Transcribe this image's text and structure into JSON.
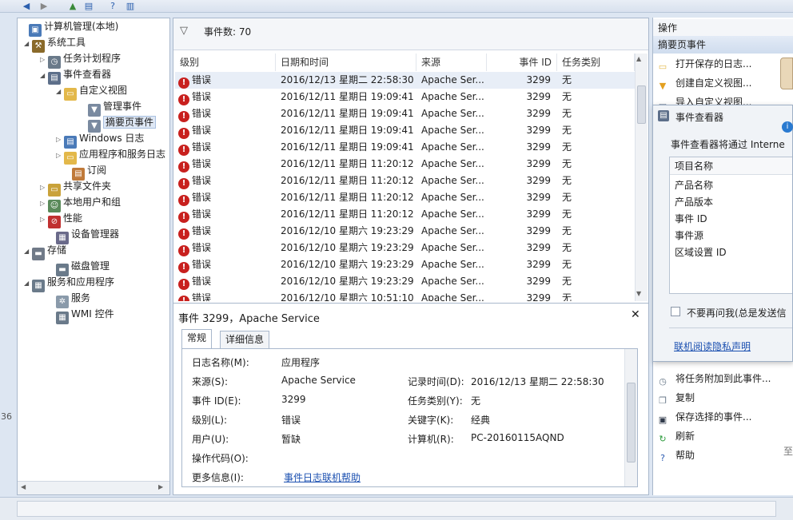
{
  "tree": {
    "items": [
      {
        "label": "计算机管理(本地)",
        "icon": "computer-icon",
        "color": "#4a7ab8",
        "glyph": "▣"
      },
      {
        "label": "系统工具",
        "icon": "tools-icon",
        "color": "#8a6a2a",
        "glyph": "⚒"
      },
      {
        "label": "任务计划程序",
        "icon": "clock-icon",
        "color": "#6a7a8a",
        "glyph": "◷"
      },
      {
        "label": "事件查看器",
        "icon": "event-viewer-icon",
        "color": "#5d6f8a",
        "glyph": "▤"
      },
      {
        "label": "自定义视图",
        "icon": "folder-icon",
        "color": "#e3b84a",
        "glyph": "▭"
      },
      {
        "label": "管理事件",
        "icon": "filter-icon",
        "color": "#7a8aa0",
        "glyph": "▼"
      },
      {
        "label": "摘要页事件",
        "icon": "filter-icon",
        "color": "#7a8aa0",
        "glyph": "▼"
      },
      {
        "label": "Windows 日志",
        "icon": "windows-log-icon",
        "color": "#4a7ab8",
        "glyph": "▤"
      },
      {
        "label": "应用程序和服务日志",
        "icon": "folder-icon",
        "color": "#e3b84a",
        "glyph": "▭"
      },
      {
        "label": "订阅",
        "icon": "subscription-icon",
        "color": "#c07a3a",
        "glyph": "▤"
      },
      {
        "label": "共享文件夹",
        "icon": "shared-folder-icon",
        "color": "#c9a23a",
        "glyph": "▭"
      },
      {
        "label": "本地用户和组",
        "icon": "users-icon",
        "color": "#5a8a5a",
        "glyph": "☺"
      },
      {
        "label": "性能",
        "icon": "performance-icon",
        "color": "#c03030",
        "glyph": "⊘"
      },
      {
        "label": "设备管理器",
        "icon": "device-manager-icon",
        "color": "#6a6a8a",
        "glyph": "▦"
      },
      {
        "label": "存储",
        "icon": "storage-icon",
        "color": "#707a88",
        "glyph": "▬"
      },
      {
        "label": "磁盘管理",
        "icon": "disk-icon",
        "color": "#6a7a8a",
        "glyph": "▬"
      },
      {
        "label": "服务和应用程序",
        "icon": "services-apps-icon",
        "color": "#6a7a8a",
        "glyph": "▦"
      },
      {
        "label": "服务",
        "icon": "services-icon",
        "color": "#8a9aaa",
        "glyph": "✲"
      },
      {
        "label": "WMI 控件",
        "icon": "wmi-icon",
        "color": "#6a7a8a",
        "glyph": "▦"
      }
    ]
  },
  "filter": {
    "label": "事件数: 70"
  },
  "grid": {
    "headers": [
      "级别",
      "日期和时间",
      "来源",
      "事件 ID",
      "任务类别"
    ],
    "rows": [
      {
        "level": "错误",
        "datetime": "2016/12/13 星期二 22:58:30",
        "source": "Apache Ser...",
        "id": "3299",
        "category": "无"
      },
      {
        "level": "错误",
        "datetime": "2016/12/11 星期日 19:09:41",
        "source": "Apache Ser...",
        "id": "3299",
        "category": "无"
      },
      {
        "level": "错误",
        "datetime": "2016/12/11 星期日 19:09:41",
        "source": "Apache Ser...",
        "id": "3299",
        "category": "无"
      },
      {
        "level": "错误",
        "datetime": "2016/12/11 星期日 19:09:41",
        "source": "Apache Ser...",
        "id": "3299",
        "category": "无"
      },
      {
        "level": "错误",
        "datetime": "2016/12/11 星期日 19:09:41",
        "source": "Apache Ser...",
        "id": "3299",
        "category": "无"
      },
      {
        "level": "错误",
        "datetime": "2016/12/11 星期日 11:20:12",
        "source": "Apache Ser...",
        "id": "3299",
        "category": "无"
      },
      {
        "level": "错误",
        "datetime": "2016/12/11 星期日 11:20:12",
        "source": "Apache Ser...",
        "id": "3299",
        "category": "无"
      },
      {
        "level": "错误",
        "datetime": "2016/12/11 星期日 11:20:12",
        "source": "Apache Ser...",
        "id": "3299",
        "category": "无"
      },
      {
        "level": "错误",
        "datetime": "2016/12/11 星期日 11:20:12",
        "source": "Apache Ser...",
        "id": "3299",
        "category": "无"
      },
      {
        "level": "错误",
        "datetime": "2016/12/10 星期六 19:23:29",
        "source": "Apache Ser...",
        "id": "3299",
        "category": "无"
      },
      {
        "level": "错误",
        "datetime": "2016/12/10 星期六 19:23:29",
        "source": "Apache Ser...",
        "id": "3299",
        "category": "无"
      },
      {
        "level": "错误",
        "datetime": "2016/12/10 星期六 19:23:29",
        "source": "Apache Ser...",
        "id": "3299",
        "category": "无"
      },
      {
        "level": "错误",
        "datetime": "2016/12/10 星期六 19:23:29",
        "source": "Apache Ser...",
        "id": "3299",
        "category": "无"
      },
      {
        "level": "错误",
        "datetime": "2016/12/10 星期六 10:51:10",
        "source": "Apache Ser...",
        "id": "3299",
        "category": "无"
      }
    ]
  },
  "detail": {
    "title": "事件 3299，Apache Service",
    "tabs": [
      "常规",
      "详细信息"
    ],
    "fields": {
      "log_name_label": "日志名称(M):",
      "log_name": "应用程序",
      "source_label": "来源(S):",
      "source": "Apache Service",
      "logged_label": "记录时间(D):",
      "logged": "2016/12/13 星期二 22:58:30",
      "event_id_label": "事件 ID(E):",
      "event_id": "3299",
      "task_label": "任务类别(Y):",
      "task": "无",
      "level_label": "级别(L):",
      "level": "错误",
      "keywords_label": "关键字(K):",
      "keywords": "经典",
      "user_label": "用户(U):",
      "user": "暂缺",
      "computer_label": "计算机(R):",
      "computer": "PC-20160115AQND",
      "opcode_label": "操作代码(O):",
      "more_info_label": "更多信息(I):",
      "more_info_link": "事件日志联机帮助"
    }
  },
  "actions": {
    "header": "操作",
    "section": "摘要页事件",
    "items_top": [
      {
        "label": "打开保存的日志...",
        "icon": "open-folder-icon",
        "color": "#e3b84a",
        "glyph": "▭"
      },
      {
        "label": "创建自定义视图...",
        "icon": "filter-icon",
        "color": "#e3a020",
        "glyph": "▼"
      },
      {
        "label": "导入自定义视图...",
        "icon": "import-icon",
        "color": "#7a8aa0",
        "glyph": "▭"
      }
    ],
    "items_bottom": [
      {
        "label": "将任务附加到此事件...",
        "icon": "task-attach-icon",
        "color": "#6a7a8a",
        "glyph": "◷"
      },
      {
        "label": "复制",
        "icon": "copy-icon",
        "color": "#6a7a8a",
        "glyph": "❐"
      },
      {
        "label": "保存选择的事件...",
        "icon": "save-icon",
        "color": "#303a4a",
        "glyph": "▣"
      },
      {
        "label": "刷新",
        "icon": "refresh-icon",
        "color": "#2a9a3a",
        "glyph": "↻"
      },
      {
        "label": "帮助",
        "icon": "help-icon",
        "color": "#2a5ab0",
        "glyph": "?"
      }
    ]
  },
  "popup": {
    "title": "事件查看器",
    "description": "事件查看器将通过 Interne",
    "list_header": "项目名称",
    "list_items": [
      "产品名称",
      "产品版本",
      "事件 ID",
      "事件源",
      "区域设置 ID"
    ],
    "checkbox_label": "不要再问我(总是发送信",
    "privacy_link": "联机阅读隐私声明"
  },
  "edge": {
    "left_a": "36",
    "left_b": "36",
    "right_char": "至"
  }
}
